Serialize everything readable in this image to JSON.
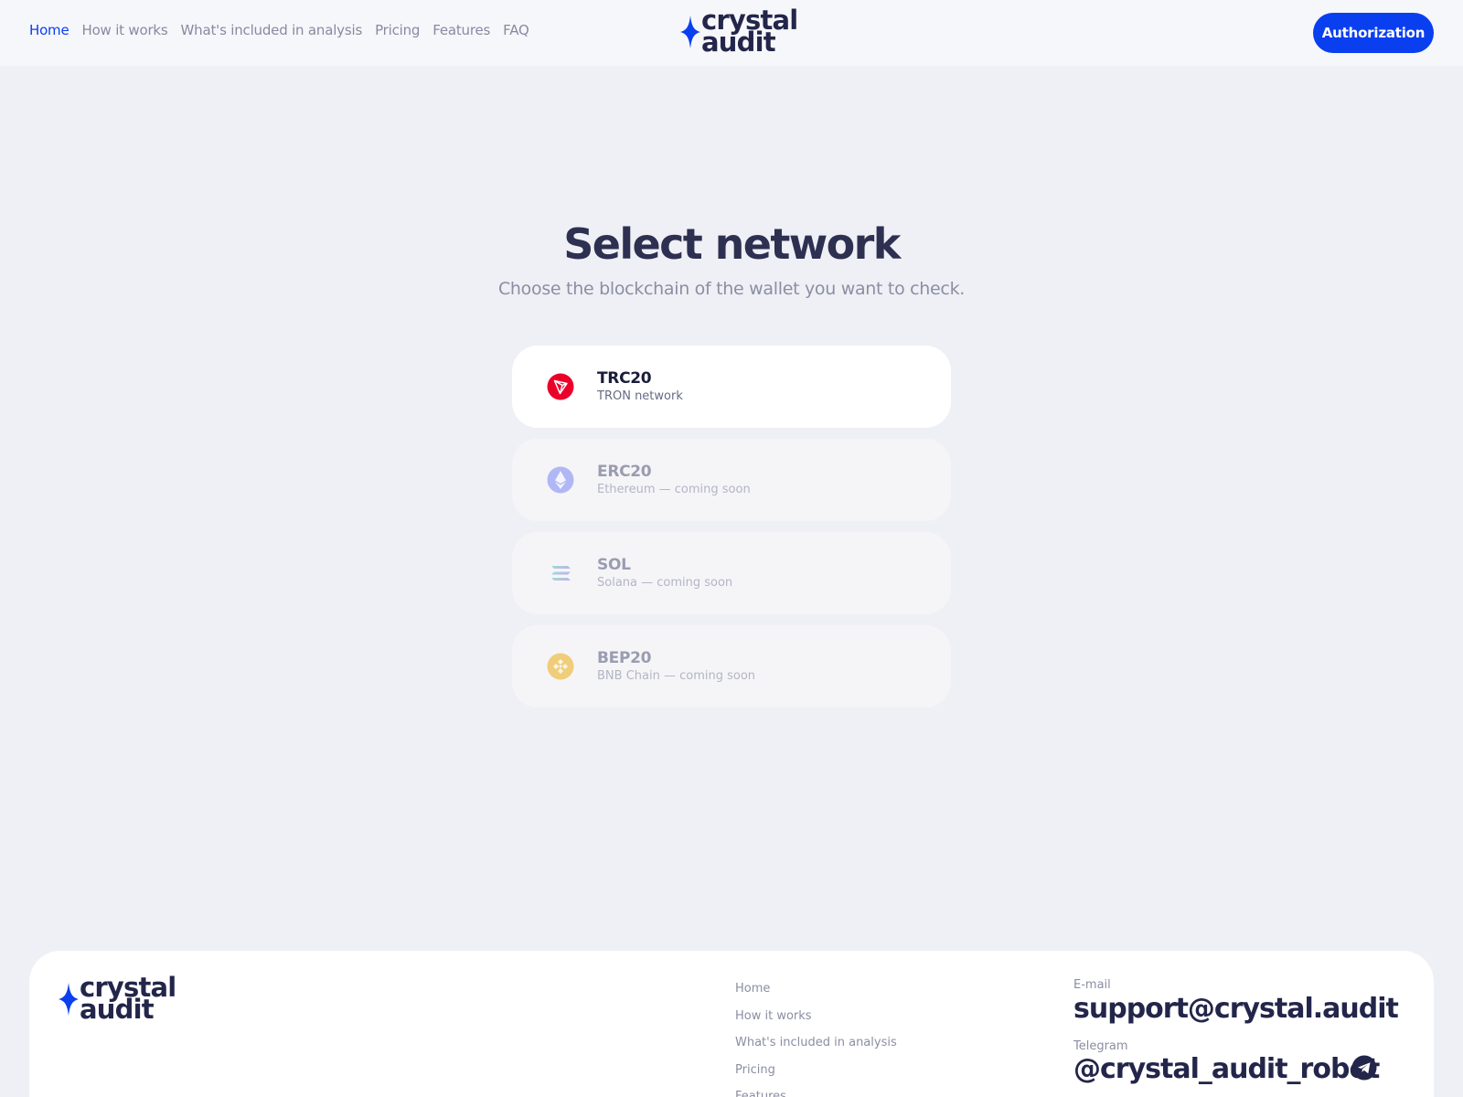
{
  "header": {
    "nav": [
      {
        "label": "Home",
        "active": true
      },
      {
        "label": "How it works"
      },
      {
        "label": "What's included in analysis"
      },
      {
        "label": "Pricing"
      },
      {
        "label": "Features"
      },
      {
        "label": "FAQ"
      }
    ],
    "logo": {
      "line1": "crystal",
      "line2": "audit"
    },
    "auth_label": "Authorization"
  },
  "main": {
    "title": "Select network",
    "subtitle": "Choose the blockchain of the wallet you want to check.",
    "networks": [
      {
        "code": "TRC20",
        "description": "TRON network",
        "icon": "tron-icon",
        "color": "#eb0029",
        "enabled": true
      },
      {
        "code": "ERC20",
        "description": "Ethereum — coming soon",
        "icon": "ethereum-icon",
        "color": "#b0b7f5",
        "enabled": false
      },
      {
        "code": "SOL",
        "description": "Solana — coming soon",
        "icon": "solana-icon",
        "color": "#9fd9cf",
        "enabled": false
      },
      {
        "code": "BEP20",
        "description": "BNB Chain — coming soon",
        "icon": "bnb-icon",
        "color": "#f0cd7a",
        "enabled": false
      }
    ]
  },
  "footer": {
    "logo": {
      "line1": "crystal",
      "line2": "audit"
    },
    "links": [
      "Home",
      "How it works",
      "What's included in analysis",
      "Pricing",
      "Features"
    ],
    "email_label": "E-mail",
    "email": "support@crystal.audit",
    "telegram_label": "Telegram",
    "telegram": "@crystal_audit_robot",
    "telegram_icon": "telegram-icon"
  },
  "colors": {
    "accent": "#0a3ff0",
    "background": "#eff0f5",
    "text": "#23264a"
  }
}
